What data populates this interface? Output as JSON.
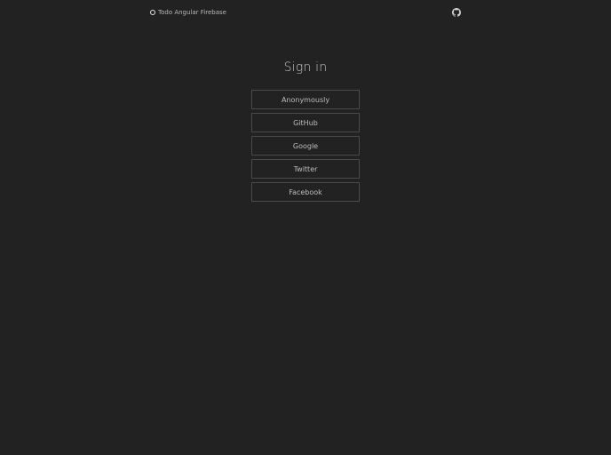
{
  "header": {
    "app_title": "Todo Angular Firebase",
    "github_icon": "github-icon"
  },
  "main": {
    "title": "Sign in",
    "buttons": [
      {
        "label": "Anonymously"
      },
      {
        "label": "GitHub"
      },
      {
        "label": "Google"
      },
      {
        "label": "Twitter"
      },
      {
        "label": "Facebook"
      }
    ]
  },
  "colors": {
    "background": "#222222",
    "text": "#bdbdbd",
    "button_border": "#4a4a4a"
  }
}
